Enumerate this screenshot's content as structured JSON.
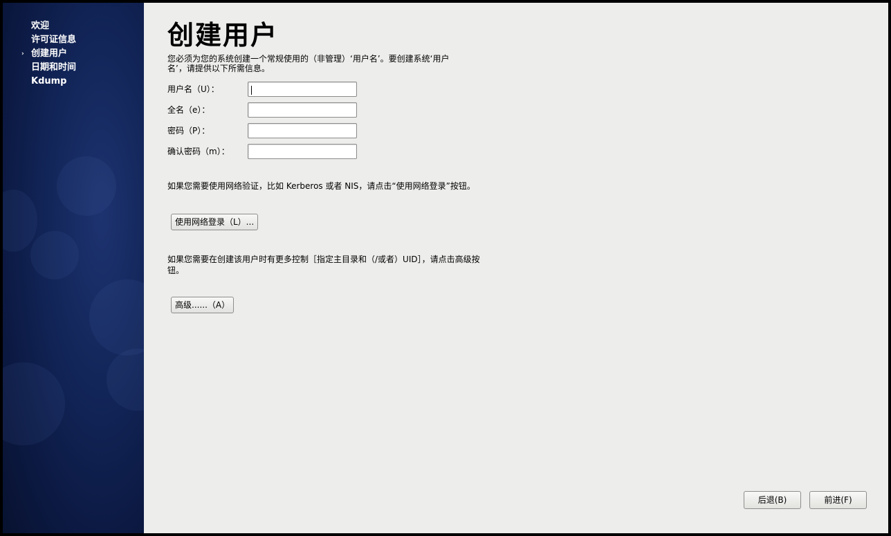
{
  "sidebar": {
    "steps": [
      {
        "label": "欢迎",
        "current": false
      },
      {
        "label": "许可证信息",
        "current": false
      },
      {
        "label": "创建用户",
        "current": true
      },
      {
        "label": "日期和时间",
        "current": false
      },
      {
        "label": "Kdump",
        "current": false
      }
    ],
    "current_marker": "›"
  },
  "main": {
    "title": "创建用户",
    "intro_line1": "您必须为您的系统创建一个常规使用的（非管理）‘用户名’。要创建系统‘用户",
    "intro_line2": "名’，请提供以下所需信息。",
    "fields": {
      "username_label": "用户名（U）：",
      "username_value": "",
      "fullname_label": "全名（e）：",
      "fullname_value": "",
      "password_label": "密码（P）：",
      "password_value": "",
      "confirm_label": "确认密码（m）：",
      "confirm_value": ""
    },
    "network_note": "如果您需要使用网络验证，比如 Kerberos 或者 NIS，请点击“使用网络登录”按钮。",
    "network_button": "使用网络登录（L）...",
    "advanced_note_line1": "如果您需要在创建该用户时有更多控制［指定主目录和（/或者）UID］，请点击高级按",
    "advanced_note_line2": "钮。",
    "advanced_button": "高级......（A）"
  },
  "footer": {
    "back_button": "后退(B)",
    "forward_button": "前进(F)"
  },
  "colors": {
    "sidebar_bg": "#122558",
    "content_bg": "#ededeb"
  }
}
